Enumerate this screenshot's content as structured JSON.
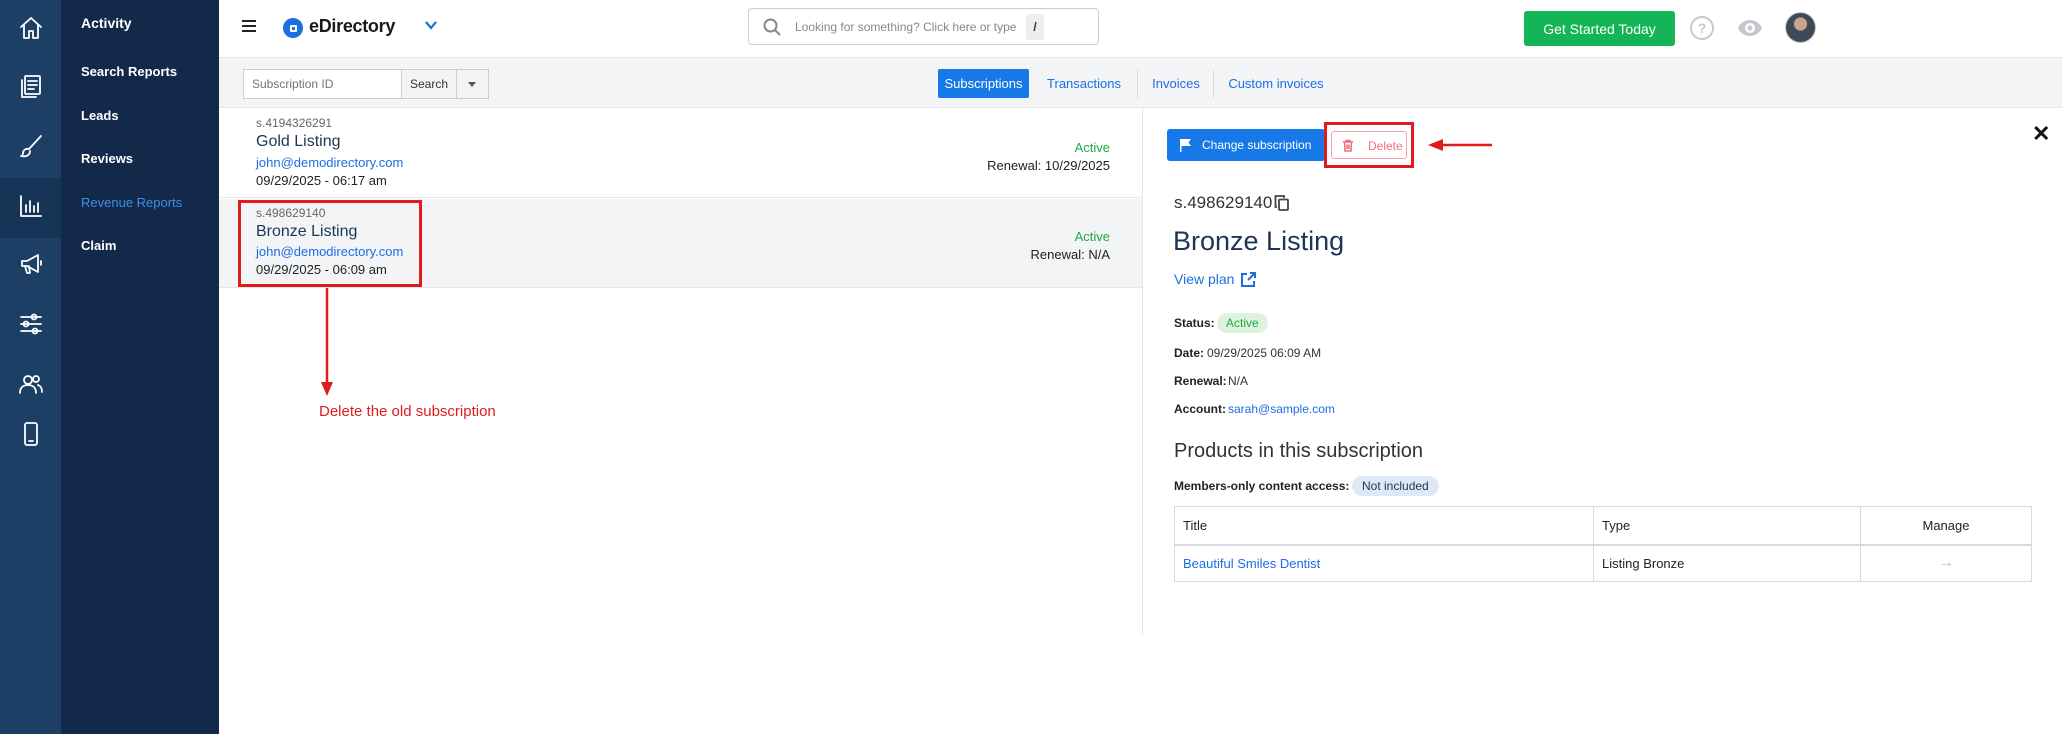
{
  "app": {
    "brand": "eDirectory"
  },
  "rail": {
    "icons": [
      "home-icon",
      "documents-icon",
      "brush-icon",
      "chart-icon",
      "megaphone-icon",
      "sliders-icon",
      "users-icon",
      "mobile-icon"
    ],
    "active_index": 3
  },
  "menu": {
    "items": [
      {
        "label": "Activity"
      },
      {
        "label": "Search Reports"
      },
      {
        "label": "Leads"
      },
      {
        "label": "Reviews"
      },
      {
        "label": "Revenue Reports"
      },
      {
        "label": "Claim"
      }
    ],
    "active_index": 4
  },
  "header": {
    "search_placeholder": "Looking for something? Click here or type",
    "search_shortcut": "/",
    "cta_label": "Get Started Today",
    "help_glyph": "?"
  },
  "toolbar": {
    "input_placeholder": "Subscription ID",
    "search_label": "Search",
    "tabs": [
      {
        "label": "Subscriptions"
      },
      {
        "label": "Transactions"
      },
      {
        "label": "Invoices"
      },
      {
        "label": "Custom invoices"
      }
    ],
    "active_tab": 0
  },
  "list": {
    "rows": [
      {
        "id": "s.4194326291",
        "title": "Gold Listing",
        "email": "john@demodirectory.com",
        "date": "09/29/2025 - 06:17 am",
        "status": "Active",
        "renewal": "Renewal: 10/29/2025"
      },
      {
        "id": "s.498629140",
        "title": "Bronze Listing",
        "email": "john@demodirectory.com",
        "date": "09/29/2025 - 06:09 am",
        "status": "Active",
        "renewal": "Renewal: N/A"
      }
    ],
    "selected_index": 1
  },
  "detail": {
    "change_label": "Change subscription",
    "delete_label": "Delete",
    "close_glyph": "✕",
    "id": "s.498629140",
    "title": "Bronze Listing",
    "view_plan": "View plan",
    "status_label": "Status:",
    "status_value": "Active",
    "date_label": "Date:",
    "date_value": "09/29/2025 06:09 AM",
    "renewal_label": "Renewal:",
    "renewal_value": "N/A",
    "account_label": "Account:",
    "account_value": "sarah@sample.com",
    "products_heading": "Products in this subscription",
    "members_label": "Members-only content access:",
    "members_value": "Not included",
    "table": {
      "headers": [
        "Title",
        "Type",
        "Manage"
      ],
      "rows": [
        {
          "title": "Beautiful Smiles Dentist",
          "type": "Listing Bronze",
          "manage": "→"
        }
      ]
    }
  },
  "annotation": {
    "text": "Delete the old subscription",
    "color": "#e01b1b"
  },
  "colors": {
    "accent": "#1779e8",
    "cta": "#13b557",
    "status_green": "#22a845",
    "rail": "#1d3f66",
    "menu": "#12294a"
  }
}
